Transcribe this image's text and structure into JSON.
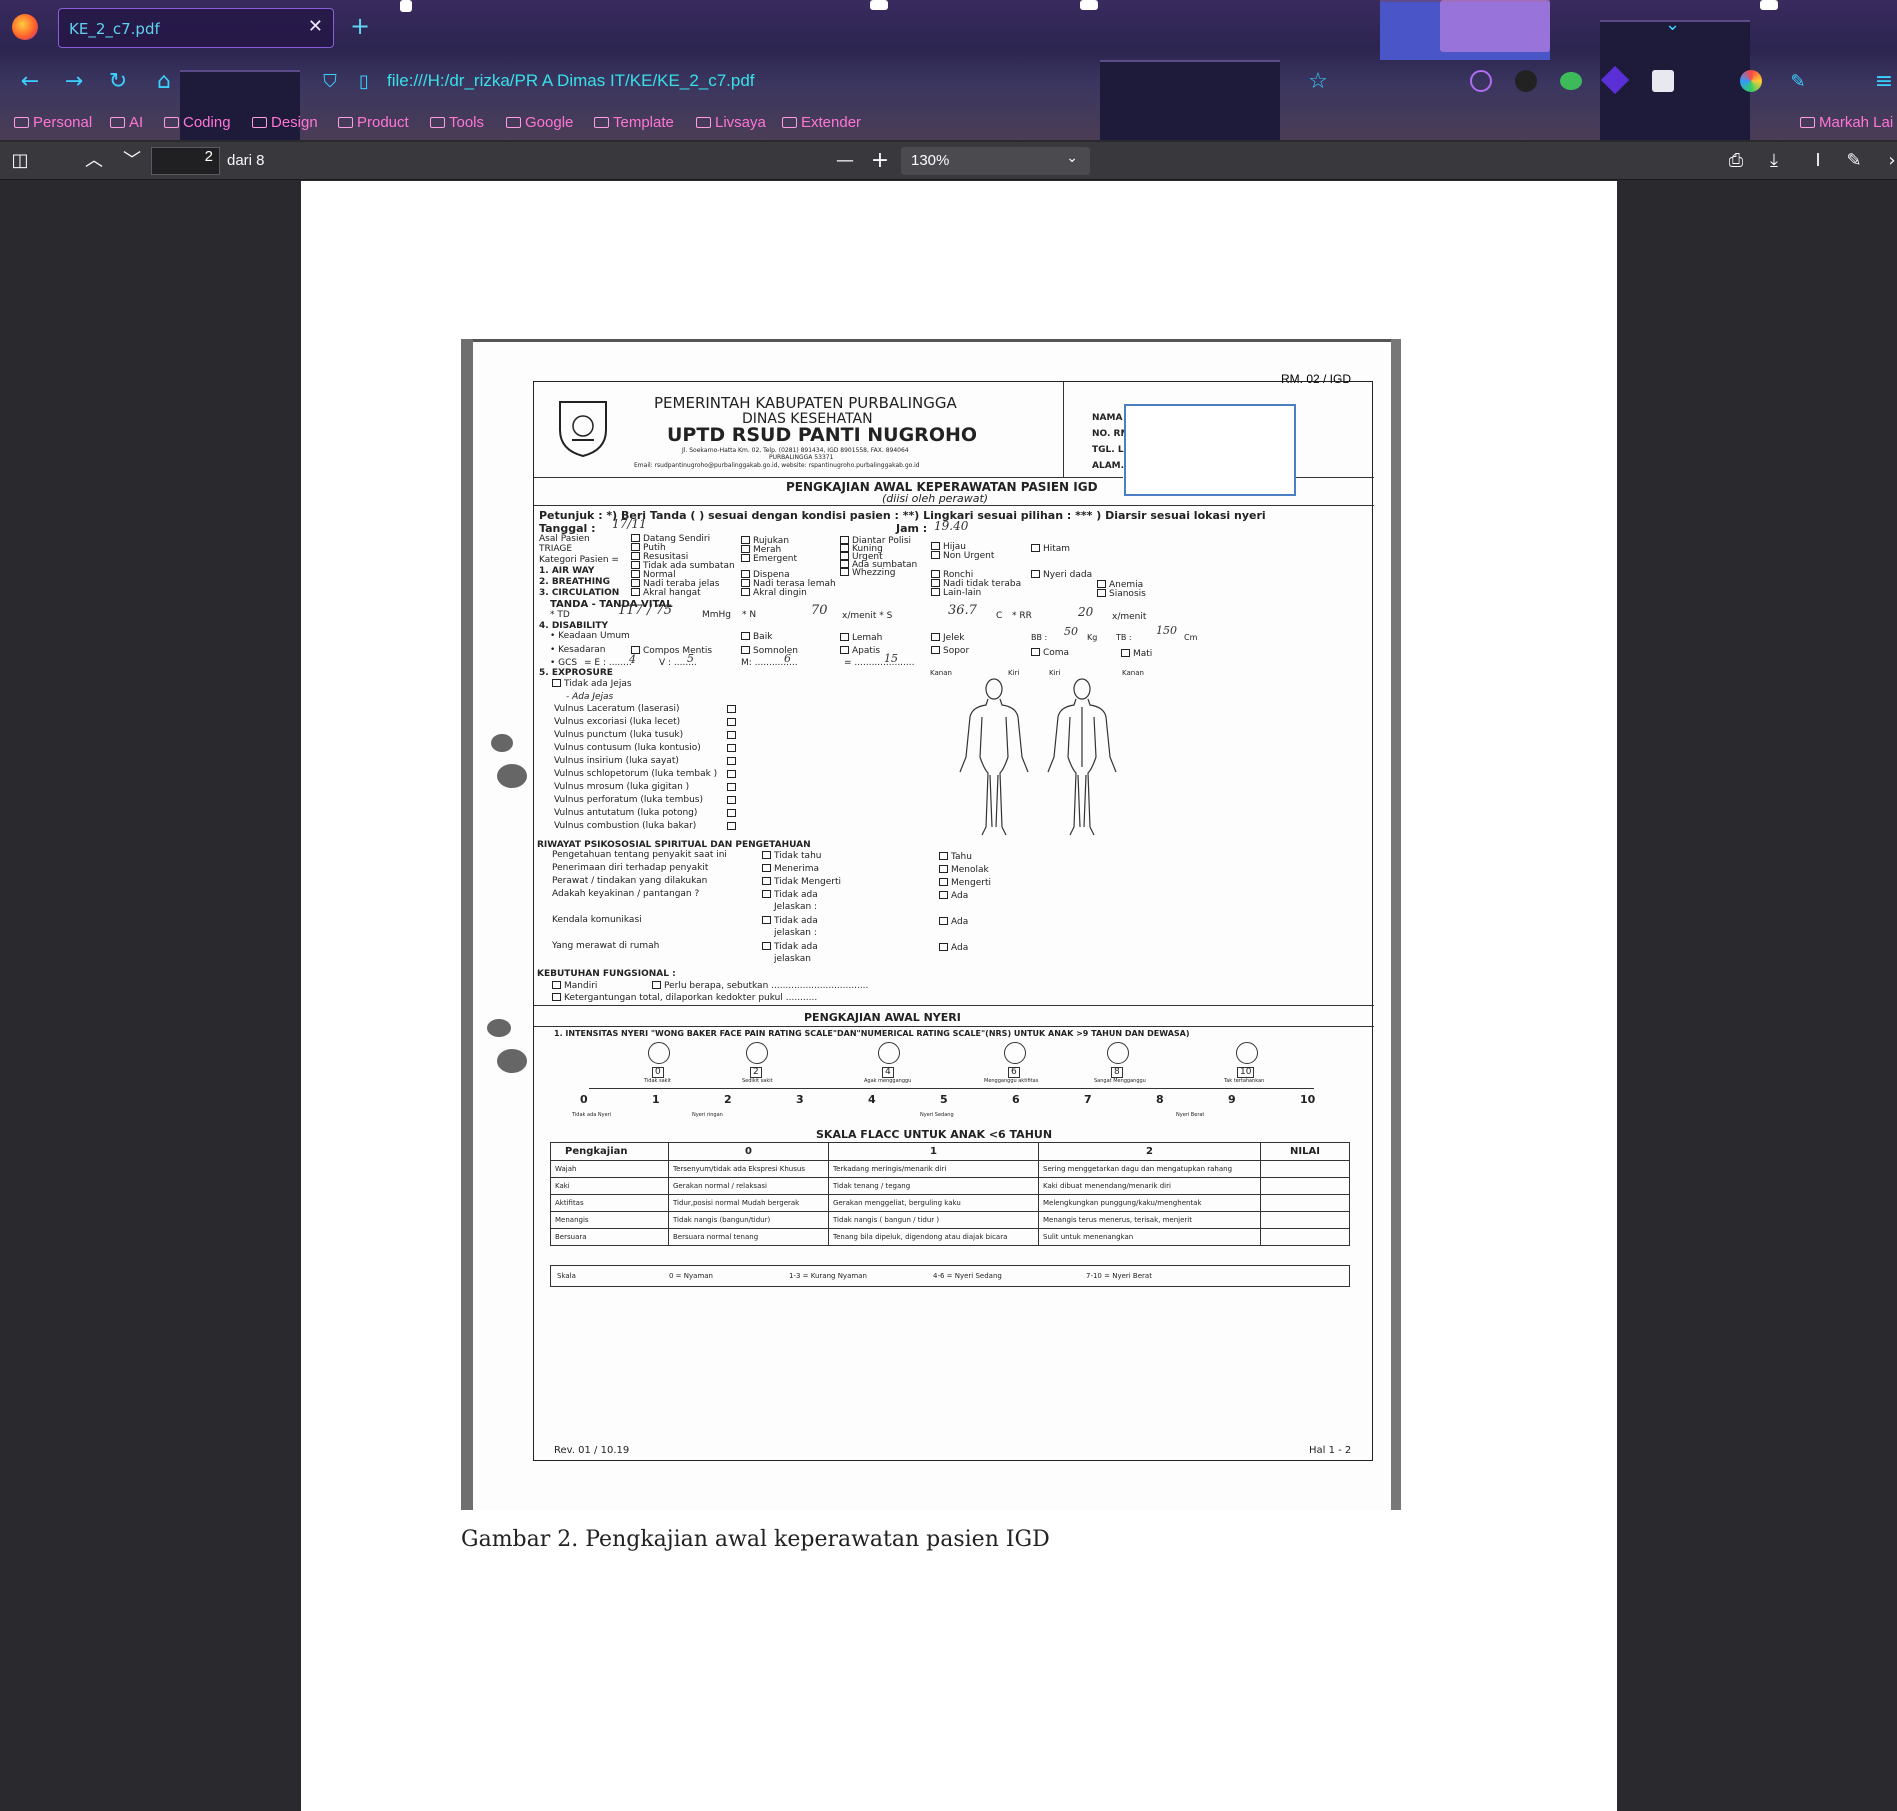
{
  "browser": {
    "tab_title": "KE_2_c7.pdf",
    "tab_close": "✕",
    "new_tab": "+",
    "url": "file:///H:/dr_rizka/PR A Dimas IT/KE/KE_2_c7.pdf",
    "bookmarks": [
      "Personal",
      "AI",
      "Coding",
      "Design",
      "Product",
      "Tools",
      "Google",
      "Template",
      "Livsaya",
      "Extender"
    ],
    "other_bookmarks": "Markah Lai"
  },
  "pdf_toolbar": {
    "page_number": "2",
    "page_of": "dari 8",
    "zoom": "130%"
  },
  "document": {
    "rm_code": "RM. 02 / IGD",
    "header": {
      "line1": "PEMERINTAH KABUPATEN PURBALINGGA",
      "line2": "DINAS KESEHATAN",
      "line3": "UPTD RSUD PANTI NUGROHO",
      "address": "Jl. Soekarno-Hatta Km. 02, Telp. (0281) 891434, IGD 8901558, FAX. 894064",
      "city": "PURBALINGGA 53371",
      "email": "Email: rsudpantinugroho@purbalinggakab.go.id, website: rspantinugroho.purbalinggakab.go.id"
    },
    "patient_labels": [
      "NAMA",
      "NO. RM",
      "TGL. L",
      "ALAM."
    ],
    "form_title": "PENGKAJIAN AWAL KEPERAWATAN PASIEN IGD",
    "form_subtitle": "(diisi oleh perawat)",
    "instructions": "Petunjuk : *) Beri Tanda ( ) sesuai dengan kondisi pasien : **) Lingkari sesuai pilihan : *** ) Diarsir sesuai lokasi nyeri",
    "tanggal_label": "Tanggal :",
    "tanggal_value": "17/11",
    "jam_label": "Jam :",
    "jam_value": "19.40",
    "rows": {
      "asal_pasien": "Asal Pasien",
      "triage": "TRIAGE",
      "kategori": "Kategori Pasien =",
      "airway": "1. AIR WAY",
      "breathing": "2. BREATHING",
      "circulation": "3. CIRCULATION"
    },
    "opts_col1": [
      "Datang Sendiri",
      "Putih",
      "Resusitasi",
      "Tidak ada sumbatan",
      "Normal",
      "Nadi teraba jelas",
      "Akral hangat"
    ],
    "opts_col2": [
      "Rujukan",
      "Merah",
      "Emergent",
      "",
      "Dispena",
      "Nadi terasa lemah",
      "Akral dingin"
    ],
    "opts_col3": [
      "Diantar Polisi",
      "Kuning",
      "Urgent",
      "Ada sumbatan",
      "Whezzing"
    ],
    "opts_col4": [
      "Hijau",
      "Non Urgent",
      "Ronchi",
      "Nadi tidak teraba",
      "Lain-lain"
    ],
    "opts_col5": [
      "Hitam",
      "Nyeri dada"
    ],
    "opts_col6": [
      "Anemia",
      "Sianosis"
    ],
    "vital": {
      "title": "TANDA - TANDA VITAL",
      "td_label": "* TD",
      "td_value": "117 / 75",
      "td_unit": "MmHg",
      "n_label": "* N",
      "n_value": "70",
      "n_unit": "x/menit * S",
      "s_value": "36.7",
      "s_unit": "C",
      "rr_label": "* RR",
      "rr_value": "20",
      "rr_unit": "x/menit"
    },
    "disability": {
      "title": "4. DISABILITY",
      "keadaan": "• Keadaan Umum",
      "kesadaran": "• Kesadaran",
      "gcs": "• GCS",
      "gcs_e": "4",
      "gcs_v": "5",
      "gcs_m": "6",
      "gcs_total": "15",
      "keadaan_opts": [
        "Baik",
        "Lemah",
        "Jelek"
      ],
      "kesadaran_opts": [
        "Compos Mentis",
        "Somnolen",
        "Apatis",
        "Sopor",
        "Coma",
        "Mati"
      ],
      "bb_label": "BB :",
      "bb_value": "50",
      "bb_unit": "Kg",
      "tb_label": "TB :",
      "tb_value": "150",
      "tb_unit": "Cm"
    },
    "exposure": {
      "title": "5. EXPROSURE",
      "no_wound": "Tidak ada Jejas",
      "has_wound": "- Ada Jejas",
      "wounds": [
        "Vulnus Laceratum (laserasi)",
        "Vulnus excoriasi (luka lecet)",
        "Vulnus punctum (luka tusuk)",
        "Vulnus contusum (luka kontusio)",
        "Vulnus insirium (luka sayat)",
        "Vulnus schlopetorum (luka tembak )",
        "Vulnus mrosum (luka gigitan )",
        "Vulnus perforatum (luka tembus)",
        "Vulnus antutatum (luka potong)",
        "Vulnus combustion (luka bakar)"
      ],
      "body_labels": [
        "Kanan",
        "Kiri",
        "Kiri",
        "Kanan"
      ]
    },
    "psiko": {
      "title": "RIWAYAT PSIKOSOSIAL SPIRITUAL DAN PENGETAHUAN",
      "items": [
        {
          "label": "Pengetahuan tentang penyakit saat ini",
          "a": "Tidak tahu",
          "b": "Tahu"
        },
        {
          "label": "Penerimaan diri terhadap penyakit",
          "a": "Menerima",
          "b": "Menolak"
        },
        {
          "label": "Perawat / tindakan yang dilakukan",
          "a": "Tidak Mengerti",
          "b": "Mengerti"
        },
        {
          "label": "Adakah keyakinan / pantangan ?",
          "a": "Tidak ada",
          "b": "Ada"
        },
        {
          "label": "Kendala komunikasi",
          "a": "Tidak ada",
          "b": "Ada"
        },
        {
          "label": "Yang merawat di rumah",
          "a": "Tidak ada",
          "b": "Ada"
        }
      ],
      "jelaskan": "Jelaskan :",
      "jelaskan2": "jelaskan :",
      "jelaskan3": "jelaskan"
    },
    "fungsional": {
      "title": "KEBUTUHAN FUNGSIONAL :",
      "mandiri": "Mandiri",
      "perlu": "Perlu berapa, sebutkan ..................................",
      "ketergantungan": "Ketergantungan total, dilaporkan kedokter pukul ..........."
    },
    "nyeri": {
      "title": "PENGKAJIAN AWAL NYERI",
      "scale_title": "1. INTENSITAS NYERI \"WONG BAKER FACE PAIN RATING SCALE\"DAN\"NUMERICAL RATING SCALE\"(NRS) UNTUK ANAK >9 TAHUN DAN DEWASA)",
      "faces": [
        "0",
        "2",
        "4",
        "6",
        "8",
        "10"
      ],
      "face_labels": [
        "Tidak sakit",
        "Sedikit sakit",
        "Agak mengganggu",
        "Mengganggu aktifitas",
        "Sangat Mengganggu",
        "Tak tertahankan"
      ],
      "numbers": [
        "0",
        "1",
        "2",
        "3",
        "4",
        "5",
        "6",
        "7",
        "8",
        "9",
        "10"
      ],
      "bottom_labels": [
        "Tidak ada Nyeri",
        "Nyeri ringan",
        "Nyeri Sedang",
        "Nyeri Berat"
      ]
    },
    "flacc": {
      "title": "SKALA FLACC UNTUK ANAK <6 TAHUN",
      "headers": [
        "Pengkajian",
        "0",
        "1",
        "2",
        "NILAI"
      ],
      "rows": [
        [
          "Wajah",
          "Tersenyum/tidak ada Ekspresi Khusus",
          "Terkadang meringis/menarik diri",
          "Sering menggetarkan dagu dan mengatupkan rahang"
        ],
        [
          "Kaki",
          "Gerakan normal / relaksasi",
          "Tidak tenang / tegang",
          "Kaki dibuat menendang/menarik diri"
        ],
        [
          "Aktifitas",
          "Tidur,posisi normal Mudah bergerak",
          "Gerakan menggeliat, berguling kaku",
          "Melengkungkan punggung/kaku/menghentak"
        ],
        [
          "Menangis",
          "Tidak nangis (bangun/tidur)",
          "Tidak nangis ( bangun / tidur )",
          "Menangis terus menerus, terisak, menjerit"
        ],
        [
          "Bersuara",
          "Bersuara normal tenang",
          "Tenang bila dipeluk, digendong atau diajak bicara",
          "Sulit untuk menenangkan"
        ]
      ],
      "skala_label": "Skala",
      "skala": [
        "0 = Nyaman",
        "1-3 = Kurang Nyaman",
        "4-6 = Nyeri Sedang",
        "7-10 = Nyeri Berat"
      ]
    },
    "footer_left": "Rev. 01 / 10.19",
    "footer_right": "Hal 1 - 2",
    "caption": "Gambar 2. Pengkajian awal keperawatan pasien IGD"
  },
  "colors": {
    "accent_cyan": "#38e0e8",
    "bookmark_pink": "#ff76d6",
    "toolbar": "#38383d",
    "viewer_bg": "#2a2a2e",
    "redaction_box": "#4a7fc4"
  },
  "icons": [
    "firefox-logo-icon",
    "back-icon",
    "forward-icon",
    "reload-icon",
    "home-icon",
    "shield-icon",
    "page-icon",
    "star-icon",
    "sidebar-toggle-icon",
    "prev-page-icon",
    "next-page-icon",
    "zoom-out-icon",
    "zoom-in-icon",
    "print-icon",
    "save-icon",
    "text-cursor-icon",
    "draw-icon"
  ]
}
